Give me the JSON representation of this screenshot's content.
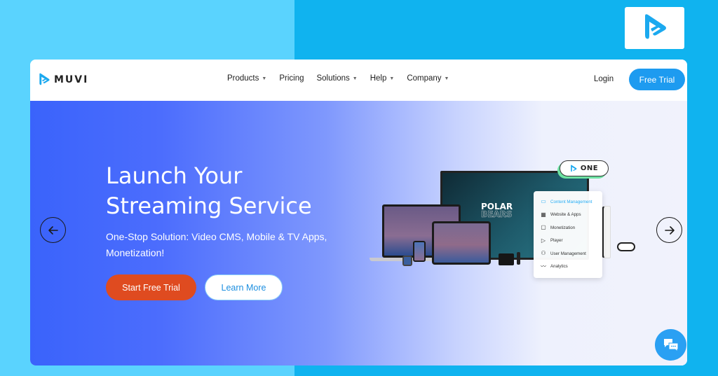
{
  "colors": {
    "bg_left": "#5ad3fe",
    "bg_right": "#10b3ef",
    "brand_blue": "#1d9bf0",
    "cta_orange": "#df4b20",
    "hero_blue": "#3a63fb"
  },
  "brand_badge": {
    "icon": "muvi-logo-icon"
  },
  "nav": {
    "logo_text": "MUVI",
    "menu": [
      {
        "label": "Products",
        "has_dropdown": true
      },
      {
        "label": "Pricing",
        "has_dropdown": false
      },
      {
        "label": "Solutions",
        "has_dropdown": true
      },
      {
        "label": "Help",
        "has_dropdown": true
      },
      {
        "label": "Company",
        "has_dropdown": true
      }
    ],
    "login_label": "Login",
    "free_trial_label": "Free Trial"
  },
  "hero": {
    "headline_line1": "Launch Your",
    "headline_line2": "Streaming Service",
    "subline": "One-Stop Solution: Video CMS, Mobile & TV Apps, Monetization!",
    "primary_cta": "Start Free Trial",
    "secondary_cta": "Learn More",
    "prev_icon": "arrow-left-icon",
    "next_icon": "arrow-right-icon"
  },
  "mockup": {
    "tv_title_line1": "POLAR",
    "tv_title_line2": "BEARS",
    "one_badge": "ONE",
    "features": [
      {
        "label": "Content Management",
        "icon": "document-icon",
        "active": true
      },
      {
        "label": "Website & Apps",
        "icon": "grid-icon",
        "active": false
      },
      {
        "label": "Monetization",
        "icon": "wallet-icon",
        "active": false
      },
      {
        "label": "Player",
        "icon": "play-icon",
        "active": false
      },
      {
        "label": "User Management",
        "icon": "user-icon",
        "active": false
      },
      {
        "label": "Analytics",
        "icon": "chart-line-icon",
        "active": false
      }
    ]
  },
  "chat": {
    "icon": "chat-bubbles-icon"
  }
}
